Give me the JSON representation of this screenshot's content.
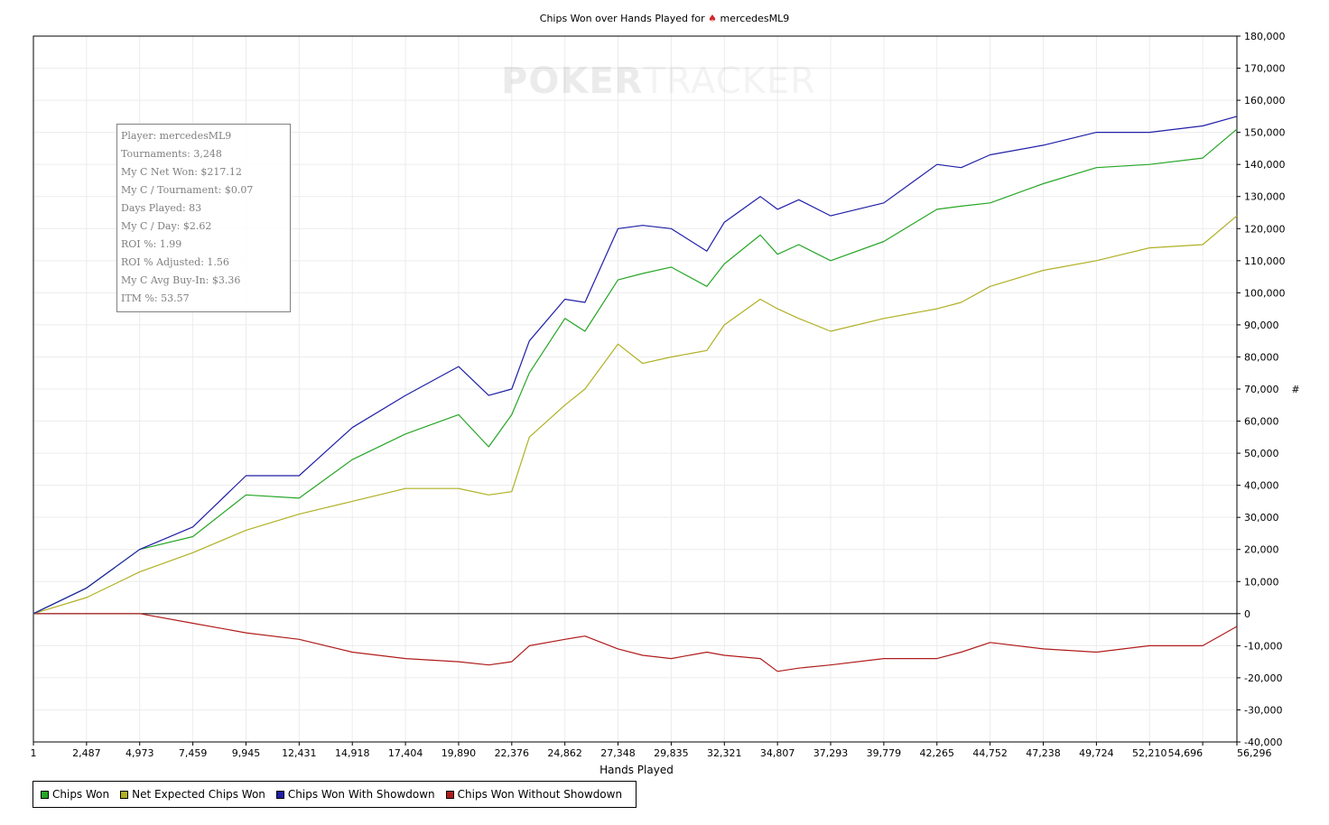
{
  "window": {
    "title_prefix": "Chips Won over Hands Played for",
    "title_suit": "♠",
    "title_player": "mercedesML9"
  },
  "watermark": {
    "part1": "POKER",
    "part2": "TRACKER"
  },
  "info_box": {
    "lines": [
      "Player: mercedesML9",
      "Tournaments: 3,248",
      "My C Net Won: $217.12",
      "My C / Tournament: $0.07",
      "Days Played: 83",
      "My C / Day: $2.62",
      "ROI %: 1.99",
      "ROI % Adjusted: 1.56",
      "My C Avg Buy-In: $3.36",
      "ITM %: 53.57"
    ]
  },
  "chart_data": {
    "type": "line",
    "title": "Chips Won over Hands Played for ♠ mercedesML9",
    "xlabel": "Hands Played",
    "ylabel": "#",
    "xlim": [
      1,
      56296
    ],
    "ylim": [
      -40000,
      180000
    ],
    "x_ticks": [
      1,
      2487,
      4973,
      7459,
      9945,
      12431,
      14918,
      17404,
      19890,
      22376,
      24862,
      27348,
      29835,
      32321,
      34807,
      37293,
      39779,
      42265,
      44752,
      47238,
      49724,
      52210,
      54696,
      56296
    ],
    "x_tick_labels": [
      "1",
      "2,487",
      "4,973",
      "7,459",
      "9,945",
      "12,431",
      "14,918",
      "17,404",
      "19,890",
      "22,376",
      "24,862",
      "27,348",
      "29,835",
      "32,321",
      "34,807",
      "37,293",
      "39,779",
      "42,265",
      "44,752",
      "47,238",
      "49,724",
      "52,210",
      "54,696",
      "56,296"
    ],
    "y_ticks": [
      -40000,
      -30000,
      -20000,
      -10000,
      0,
      10000,
      20000,
      30000,
      40000,
      50000,
      60000,
      70000,
      80000,
      90000,
      100000,
      110000,
      120000,
      130000,
      140000,
      150000,
      160000,
      170000,
      180000
    ],
    "y_tick_labels": [
      "-40,000",
      "-30,000",
      "-20,000",
      "-10,000",
      "0",
      "10,000",
      "20,000",
      "30,000",
      "40,000",
      "50,000",
      "60,000",
      "70,000",
      "80,000",
      "90,000",
      "100,000",
      "110,000",
      "120,000",
      "130,000",
      "140,000",
      "150,000",
      "160,000",
      "170,000",
      "180,000"
    ],
    "axis_position": "right",
    "grid": true,
    "legend": "bottom-left",
    "x": [
      1,
      2487,
      4973,
      7459,
      9945,
      12431,
      14918,
      17404,
      19890,
      21300,
      22376,
      23200,
      24862,
      25800,
      27348,
      28500,
      29835,
      31500,
      32321,
      34000,
      34807,
      35800,
      37293,
      39779,
      42265,
      43400,
      44752,
      47238,
      49724,
      52210,
      54696,
      56296
    ],
    "series": [
      {
        "name": "Chips Won",
        "color": "#26a626",
        "values": [
          0,
          8000,
          20000,
          24000,
          37000,
          36000,
          48000,
          56000,
          62000,
          52000,
          62000,
          75000,
          92000,
          88000,
          104000,
          106000,
          108000,
          102000,
          109000,
          118000,
          112000,
          115000,
          110000,
          116000,
          126000,
          127000,
          128000,
          134000,
          139000,
          140000,
          142000,
          151000
        ]
      },
      {
        "name": "Net Expected Chips Won",
        "color": "#b0b024",
        "values": [
          0,
          5000,
          13000,
          19000,
          26000,
          31000,
          35000,
          39000,
          39000,
          37000,
          38000,
          55000,
          65000,
          70000,
          84000,
          78000,
          80000,
          82000,
          90000,
          98000,
          95000,
          92000,
          88000,
          92000,
          95000,
          97000,
          102000,
          107000,
          110000,
          114000,
          115000,
          124000
        ]
      },
      {
        "name": "Chips Won With Showdown",
        "color": "#1f1fa8",
        "values": [
          0,
          8000,
          20000,
          27000,
          43000,
          43000,
          58000,
          68000,
          77000,
          68000,
          70000,
          85000,
          98000,
          97000,
          120000,
          121000,
          120000,
          113000,
          122000,
          130000,
          126000,
          129000,
          124000,
          128000,
          140000,
          139000,
          143000,
          146000,
          150000,
          150000,
          152000,
          155000
        ]
      },
      {
        "name": "Chips Won Without Showdown",
        "color": "#b01c1c",
        "values": [
          0,
          0,
          0,
          -3000,
          -6000,
          -8000,
          -12000,
          -14000,
          -15000,
          -16000,
          -15000,
          -10000,
          -8000,
          -7000,
          -11000,
          -13000,
          -14000,
          -12000,
          -13000,
          -14000,
          -18000,
          -17000,
          -16000,
          -14000,
          -14000,
          -12000,
          -9000,
          -11000,
          -12000,
          -10000,
          -10000,
          -4000
        ]
      }
    ]
  }
}
